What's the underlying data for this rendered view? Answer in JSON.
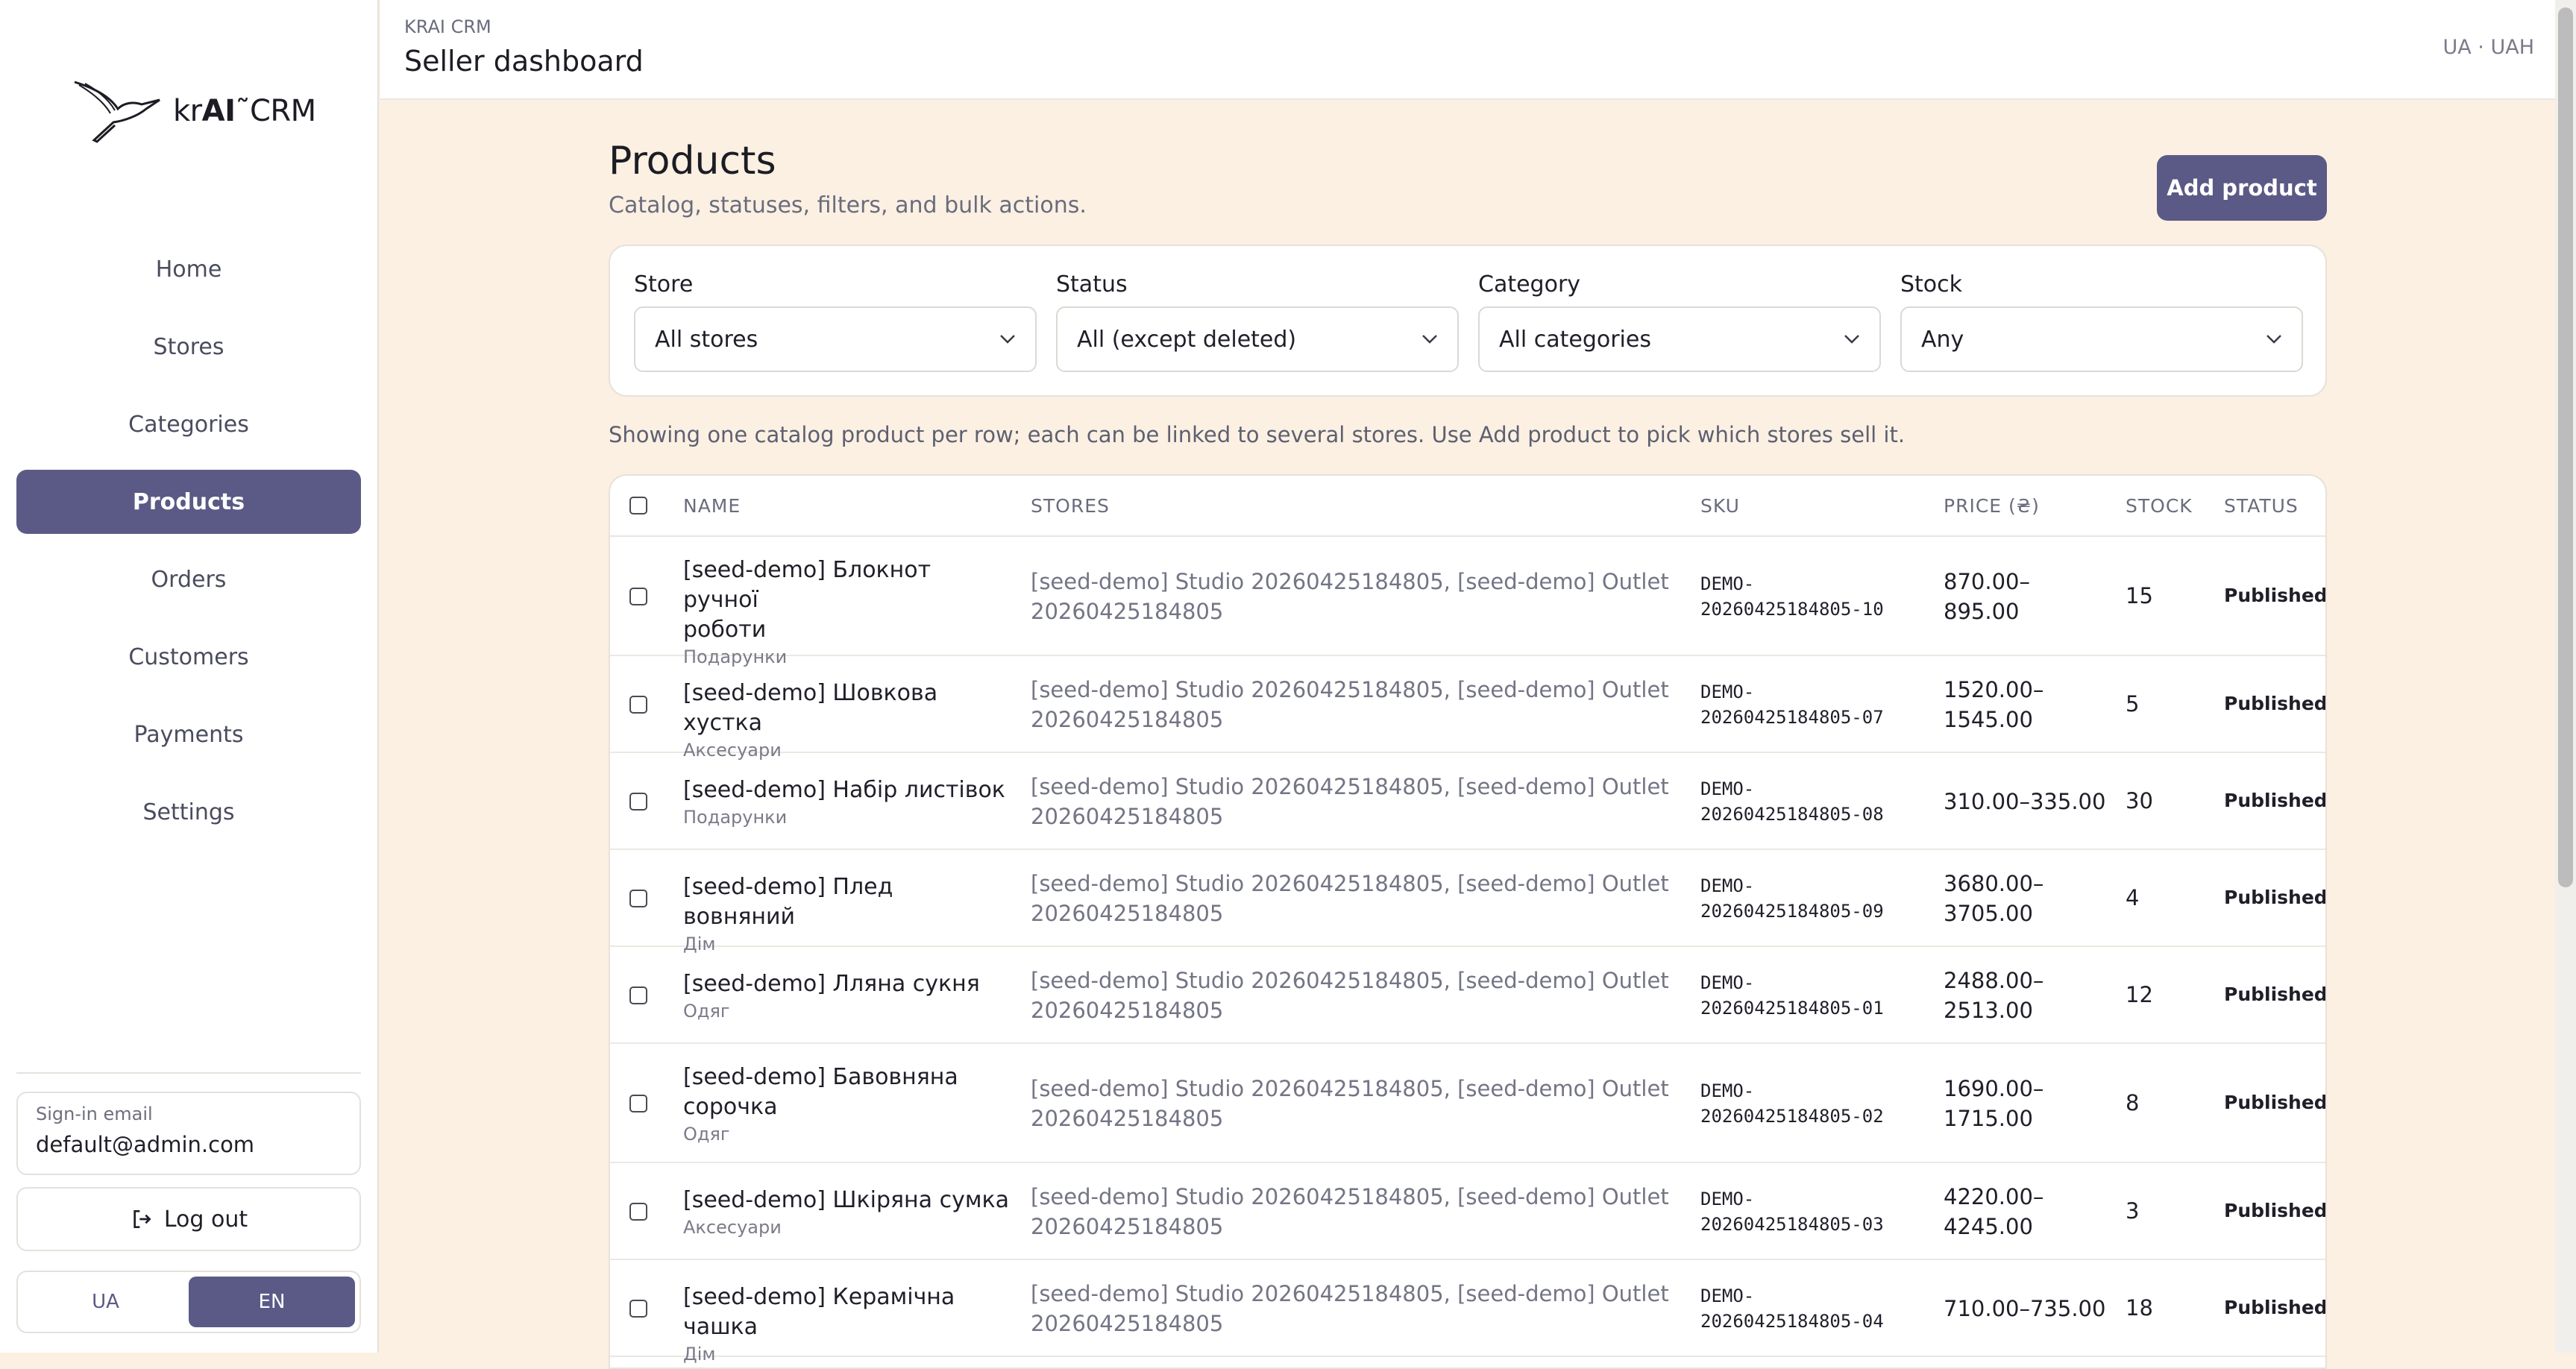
{
  "app": {
    "logo_prefix": "kr",
    "logo_ai": "AI",
    "logo_suffix": "CRM",
    "brand_small": "KRAI CRM",
    "dashboard_title": "Seller dashboard",
    "locale": "UA · UAH"
  },
  "sidebar": {
    "items": [
      {
        "label": "Home"
      },
      {
        "label": "Stores"
      },
      {
        "label": "Categories"
      },
      {
        "label": "Products"
      },
      {
        "label": "Orders"
      },
      {
        "label": "Customers"
      },
      {
        "label": "Payments"
      },
      {
        "label": "Settings"
      }
    ],
    "active": "Products",
    "email_label": "Sign-in email",
    "email_value": "default@admin.com",
    "logout_label": "Log out",
    "lang_ua": "UA",
    "lang_en": "EN",
    "lang_selected": "EN"
  },
  "page": {
    "title": "Products",
    "subtitle": "Catalog, statuses, filters, and bulk actions.",
    "add_button": "Add product",
    "hint": "Showing one catalog product per row; each can be linked to several stores. Use Add product to pick which stores sell it."
  },
  "filters": {
    "store": {
      "label": "Store",
      "value": "All stores"
    },
    "status": {
      "label": "Status",
      "value": "All (except deleted)"
    },
    "category": {
      "label": "Category",
      "value": "All categories"
    },
    "stock": {
      "label": "Stock",
      "value": "Any"
    }
  },
  "table": {
    "headers": {
      "name": "NAME",
      "stores": "STORES",
      "sku": "SKU",
      "price": "PRICE (₴)",
      "stock": "STOCK",
      "status": "STATUS"
    },
    "rows": [
      {
        "name_l1": "[seed-demo] Блокнот ручної",
        "name_l2": "роботи",
        "category": "Подарунки",
        "stores_l1": "[seed-demo] Studio 20260425184805, [seed-demo] Outlet",
        "stores_l2": "20260425184805",
        "sku_l1": "DEMO-",
        "sku_l2": "20260425184805-10",
        "price_l1": "870.00–",
        "price_l2": "895.00",
        "stock": "15",
        "status": "Published"
      },
      {
        "name_l1": "[seed-demo] Шовкова хустка",
        "name_l2": "",
        "category": "Аксесуари",
        "stores_l1": "[seed-demo] Studio 20260425184805, [seed-demo] Outlet",
        "stores_l2": "20260425184805",
        "sku_l1": "DEMO-",
        "sku_l2": "20260425184805-07",
        "price_l1": "1520.00–",
        "price_l2": "1545.00",
        "stock": "5",
        "status": "Published"
      },
      {
        "name_l1": "[seed-demo] Набір листівок",
        "name_l2": "",
        "category": "Подарунки",
        "stores_l1": "[seed-demo] Studio 20260425184805, [seed-demo] Outlet",
        "stores_l2": "20260425184805",
        "sku_l1": "DEMO-",
        "sku_l2": "20260425184805-08",
        "price_l1": "310.00–335.00",
        "price_l2": "",
        "stock": "30",
        "status": "Published"
      },
      {
        "name_l1": "[seed-demo] Плед вовняний",
        "name_l2": "",
        "category": "Дім",
        "stores_l1": "[seed-demo] Studio 20260425184805, [seed-demo] Outlet",
        "stores_l2": "20260425184805",
        "sku_l1": "DEMO-",
        "sku_l2": "20260425184805-09",
        "price_l1": "3680.00–",
        "price_l2": "3705.00",
        "stock": "4",
        "status": "Published"
      },
      {
        "name_l1": "[seed-demo] Лляна сукня",
        "name_l2": "",
        "category": "Одяг",
        "stores_l1": "[seed-demo] Studio 20260425184805, [seed-demo] Outlet",
        "stores_l2": "20260425184805",
        "sku_l1": "DEMO-",
        "sku_l2": "20260425184805-01",
        "price_l1": "2488.00–",
        "price_l2": "2513.00",
        "stock": "12",
        "status": "Published"
      },
      {
        "name_l1": "[seed-demo] Бавовняна",
        "name_l2": "сорочка",
        "category": "Одяг",
        "stores_l1": "[seed-demo] Studio 20260425184805, [seed-demo] Outlet",
        "stores_l2": "20260425184805",
        "sku_l1": "DEMO-",
        "sku_l2": "20260425184805-02",
        "price_l1": "1690.00–",
        "price_l2": "1715.00",
        "stock": "8",
        "status": "Published"
      },
      {
        "name_l1": "[seed-demo] Шкіряна сумка",
        "name_l2": "",
        "category": "Аксесуари",
        "stores_l1": "[seed-demo] Studio 20260425184805, [seed-demo] Outlet",
        "stores_l2": "20260425184805",
        "sku_l1": "DEMO-",
        "sku_l2": "20260425184805-03",
        "price_l1": "4220.00–",
        "price_l2": "4245.00",
        "stock": "3",
        "status": "Published"
      },
      {
        "name_l1": "[seed-demo] Керамічна чашка",
        "name_l2": "",
        "category": "Дім",
        "stores_l1": "[seed-demo] Studio 20260425184805, [seed-demo] Outlet",
        "stores_l2": "20260425184805",
        "sku_l1": "DEMO-",
        "sku_l2": "20260425184805-04",
        "price_l1": "710.00–735.00",
        "price_l2": "",
        "stock": "18",
        "status": "Published"
      }
    ]
  }
}
